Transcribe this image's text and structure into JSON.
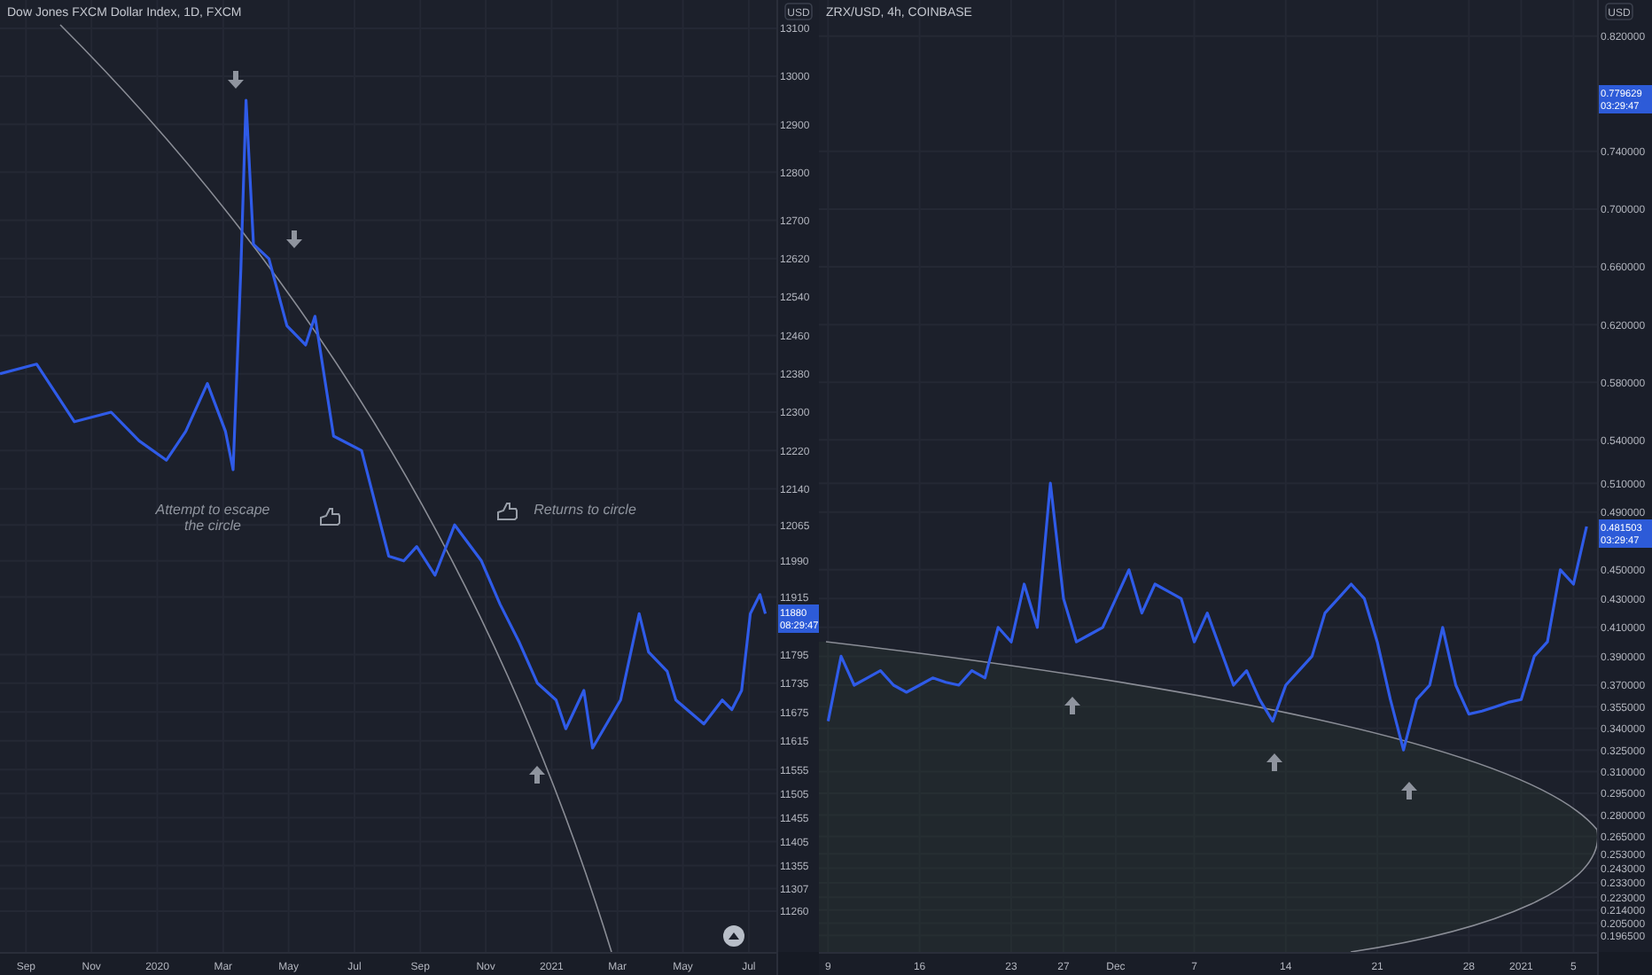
{
  "charts": [
    {
      "notes": [
        {
          "lines": [
            "Attempt to escape",
            "the circle"
          ]
        },
        {
          "lines": [
            "Returns to circle"
          ]
        }
      ],
      "price_tags": [
        {
          "price": "11880",
          "time": "08:29:47"
        }
      ],
      "chart_data": {
        "type": "line",
        "title": "Dow Jones FXCM Dollar Index, 1D, FXCM",
        "ylabel": "USD",
        "ylim": [
          11175,
          13159
        ],
        "grid": true,
        "x": [
          2019.601,
          2019.694,
          2019.79,
          2019.883,
          2019.954,
          2020.023,
          2020.072,
          2020.127,
          2020.173,
          2020.192,
          2020.212,
          2020.225,
          2020.244,
          2020.283,
          2020.329,
          2020.376,
          2020.4,
          2020.447,
          2020.518,
          2020.587,
          2020.625,
          2020.658,
          2020.704,
          2020.754,
          2020.822,
          2020.869,
          2020.918,
          2020.964,
          2021.011,
          2021.036,
          2021.082,
          2021.104,
          2021.175,
          2021.222,
          2021.246,
          2021.293,
          2021.315,
          2021.386,
          2021.433,
          2021.457,
          2021.482,
          2021.504,
          2021.528,
          2021.542
        ],
        "series": [
          {
            "color": "#2f5be8",
            "values": [
              12380,
              12400,
              12280,
              12300,
              12240,
              12200,
              12260,
              12360,
              12260,
              12180,
              12600,
              12950,
              12650,
              12620,
              12480,
              12440,
              12500,
              12250,
              12220,
              12000,
              11990,
              12020,
              11960,
              12065,
              11990,
              11900,
              11820,
              11735,
              11700,
              11640,
              11720,
              11600,
              11700,
              11880,
              11800,
              11760,
              11700,
              11650,
              11700,
              11680,
              11720,
              11880,
              11920,
              11880
            ]
          }
        ],
        "xlim": [
          2019.601,
          2021.57
        ],
        "xticks": [
          {
            "value": 2019.667,
            "label": "Sep"
          },
          {
            "value": 2019.833,
            "label": "Nov"
          },
          {
            "value": 2020,
            "label": "2020"
          },
          {
            "value": 2020.167,
            "label": "Mar"
          },
          {
            "value": 2020.333,
            "label": "May"
          },
          {
            "value": 2020.5,
            "label": "Jul"
          },
          {
            "value": 2020.667,
            "label": "Sep"
          },
          {
            "value": 2020.833,
            "label": "Nov"
          },
          {
            "value": 2021,
            "label": "2021"
          },
          {
            "value": 2021.167,
            "label": "Mar"
          },
          {
            "value": 2021.333,
            "label": "May"
          },
          {
            "value": 2021.5,
            "label": "Jul"
          }
        ],
        "yticks": [
          13100,
          13000,
          12900,
          12800,
          12700,
          12620,
          12540,
          12460,
          12380,
          12300,
          12220,
          12140,
          12065,
          11990,
          11915,
          11795,
          11735,
          11675,
          11615,
          11555,
          11505,
          11455,
          11405,
          11355,
          11307,
          11260
        ]
      }
    },
    {
      "price_tags": [
        {
          "price": "0.779629",
          "time": "03:29:47"
        },
        {
          "price": "0.481503",
          "time": "03:29:47"
        }
      ],
      "chart_data": {
        "type": "line",
        "title": "ZRX/USD, 4h, COINBASE",
        "ylabel": "USD",
        "ylim": [
          0.185,
          0.845
        ],
        "grid": true,
        "categories": [
          "9",
          null,
          null,
          null,
          null,
          null,
          null,
          "16",
          null,
          null,
          null,
          null,
          null,
          null,
          "23",
          null,
          null,
          null,
          "27",
          null,
          null,
          null,
          "Dec",
          null,
          null,
          null,
          null,
          null,
          "7",
          null,
          null,
          null,
          null,
          null,
          null,
          "14",
          null,
          null,
          null,
          null,
          null,
          null,
          "21",
          null,
          null,
          null,
          null,
          null,
          null,
          "28",
          null,
          null,
          null,
          "2021",
          null,
          null,
          null,
          "5",
          null
        ],
        "series": [
          {
            "color": "#2f5be8",
            "values": [
              0.345,
              0.39,
              0.37,
              0.375,
              0.38,
              0.37,
              0.365,
              0.37,
              0.375,
              0.372,
              0.37,
              0.38,
              0.375,
              0.41,
              0.4,
              0.44,
              0.41,
              0.51,
              0.43,
              0.4,
              0.405,
              0.41,
              0.43,
              0.45,
              0.42,
              0.44,
              0.435,
              0.43,
              0.4,
              0.42,
              0.395,
              0.37,
              0.38,
              0.36,
              0.345,
              0.37,
              0.38,
              0.39,
              0.42,
              0.43,
              0.44,
              0.43,
              0.4,
              0.36,
              0.325,
              0.36,
              0.37,
              0.41,
              0.37,
              0.35,
              0.352,
              0.355,
              0.358,
              0.36,
              0.39,
              0.4,
              0.45,
              0.44,
              0.48
            ]
          }
        ],
        "yticks": [
          {
            "value": 0.82,
            "label": "0.820000"
          },
          {
            "value": 0.74,
            "label": "0.740000"
          },
          {
            "value": 0.7,
            "label": "0.700000"
          },
          {
            "value": 0.66,
            "label": "0.660000"
          },
          {
            "value": 0.62,
            "label": "0.620000"
          },
          {
            "value": 0.58,
            "label": "0.580000"
          },
          {
            "value": 0.54,
            "label": "0.540000"
          },
          {
            "value": 0.51,
            "label": "0.510000"
          },
          {
            "value": 0.49,
            "label": "0.490000"
          },
          {
            "value": 0.45,
            "label": "0.450000"
          },
          {
            "value": 0.43,
            "label": "0.430000"
          },
          {
            "value": 0.41,
            "label": "0.410000"
          },
          {
            "value": 0.39,
            "label": "0.390000"
          },
          {
            "value": 0.37,
            "label": "0.370000"
          },
          {
            "value": 0.355,
            "label": "0.355000"
          },
          {
            "value": 0.34,
            "label": "0.340000"
          },
          {
            "value": 0.325,
            "label": "0.325000"
          },
          {
            "value": 0.31,
            "label": "0.310000"
          },
          {
            "value": 0.295,
            "label": "0.295000"
          },
          {
            "value": 0.28,
            "label": "0.280000"
          },
          {
            "value": 0.265,
            "label": "0.265000"
          },
          {
            "value": 0.253,
            "label": "0.253000"
          },
          {
            "value": 0.243,
            "label": "0.243000"
          },
          {
            "value": 0.233,
            "label": "0.233000"
          },
          {
            "value": 0.223,
            "label": "0.223000"
          },
          {
            "value": 0.214,
            "label": "0.214000"
          },
          {
            "value": 0.205,
            "label": "0.205000"
          },
          {
            "value": 0.1965,
            "label": "0.196500"
          }
        ]
      }
    }
  ]
}
